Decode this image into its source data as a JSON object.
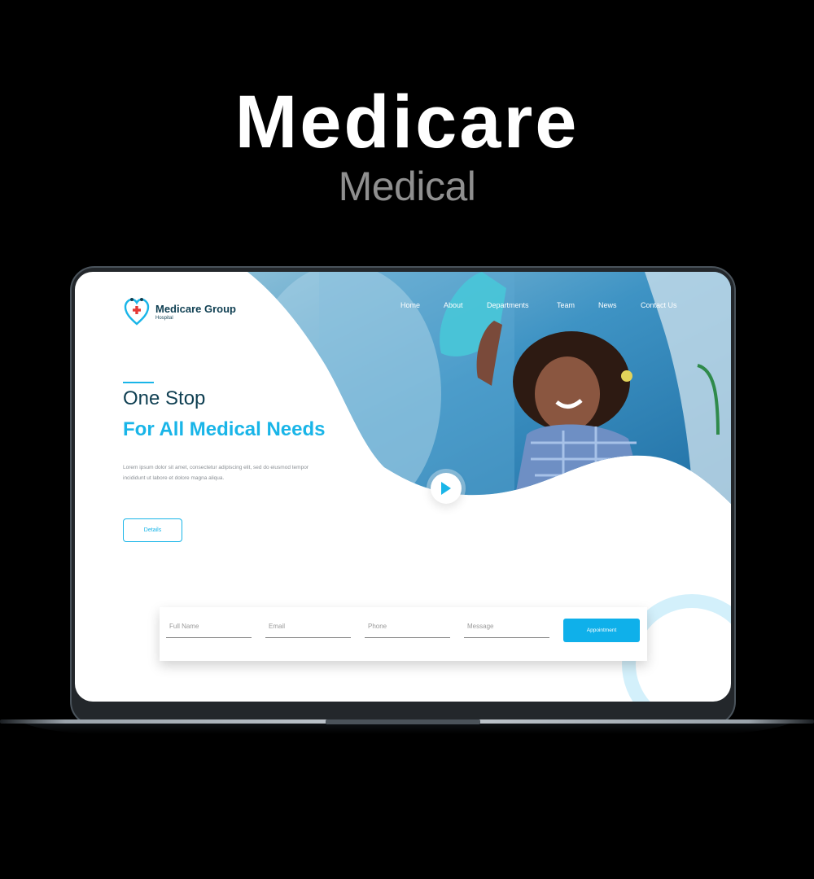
{
  "header": {
    "title": "Medicare",
    "subtitle": "Medical"
  },
  "site": {
    "logo": {
      "name": "Medicare Group",
      "tagline": "Hospital"
    },
    "nav": [
      "Home",
      "About",
      "Departments",
      "Team",
      "News",
      "Contact Us"
    ],
    "hero": {
      "title_line1": "One Stop",
      "title_line2": "For All Medical Needs",
      "body_line1": "Lorem ipsum dolor sit amet, consectetur adipiscing elit, sed do eiusmod tempor",
      "body_line2": "incididunt ut labore et dolore magna aliqua.",
      "details_label": "Details"
    },
    "form": {
      "full_name_placeholder": "Full Name",
      "email_placeholder": "Email",
      "phone_placeholder": "Phone",
      "message_placeholder": "Message",
      "submit_label": "Appointment"
    }
  },
  "colors": {
    "accent": "#19b5e8",
    "navy": "#0f3f52",
    "button": "#0fb0ea",
    "background": "#000000"
  },
  "icons": [
    "heart-stethoscope-logo-icon",
    "play-icon"
  ]
}
